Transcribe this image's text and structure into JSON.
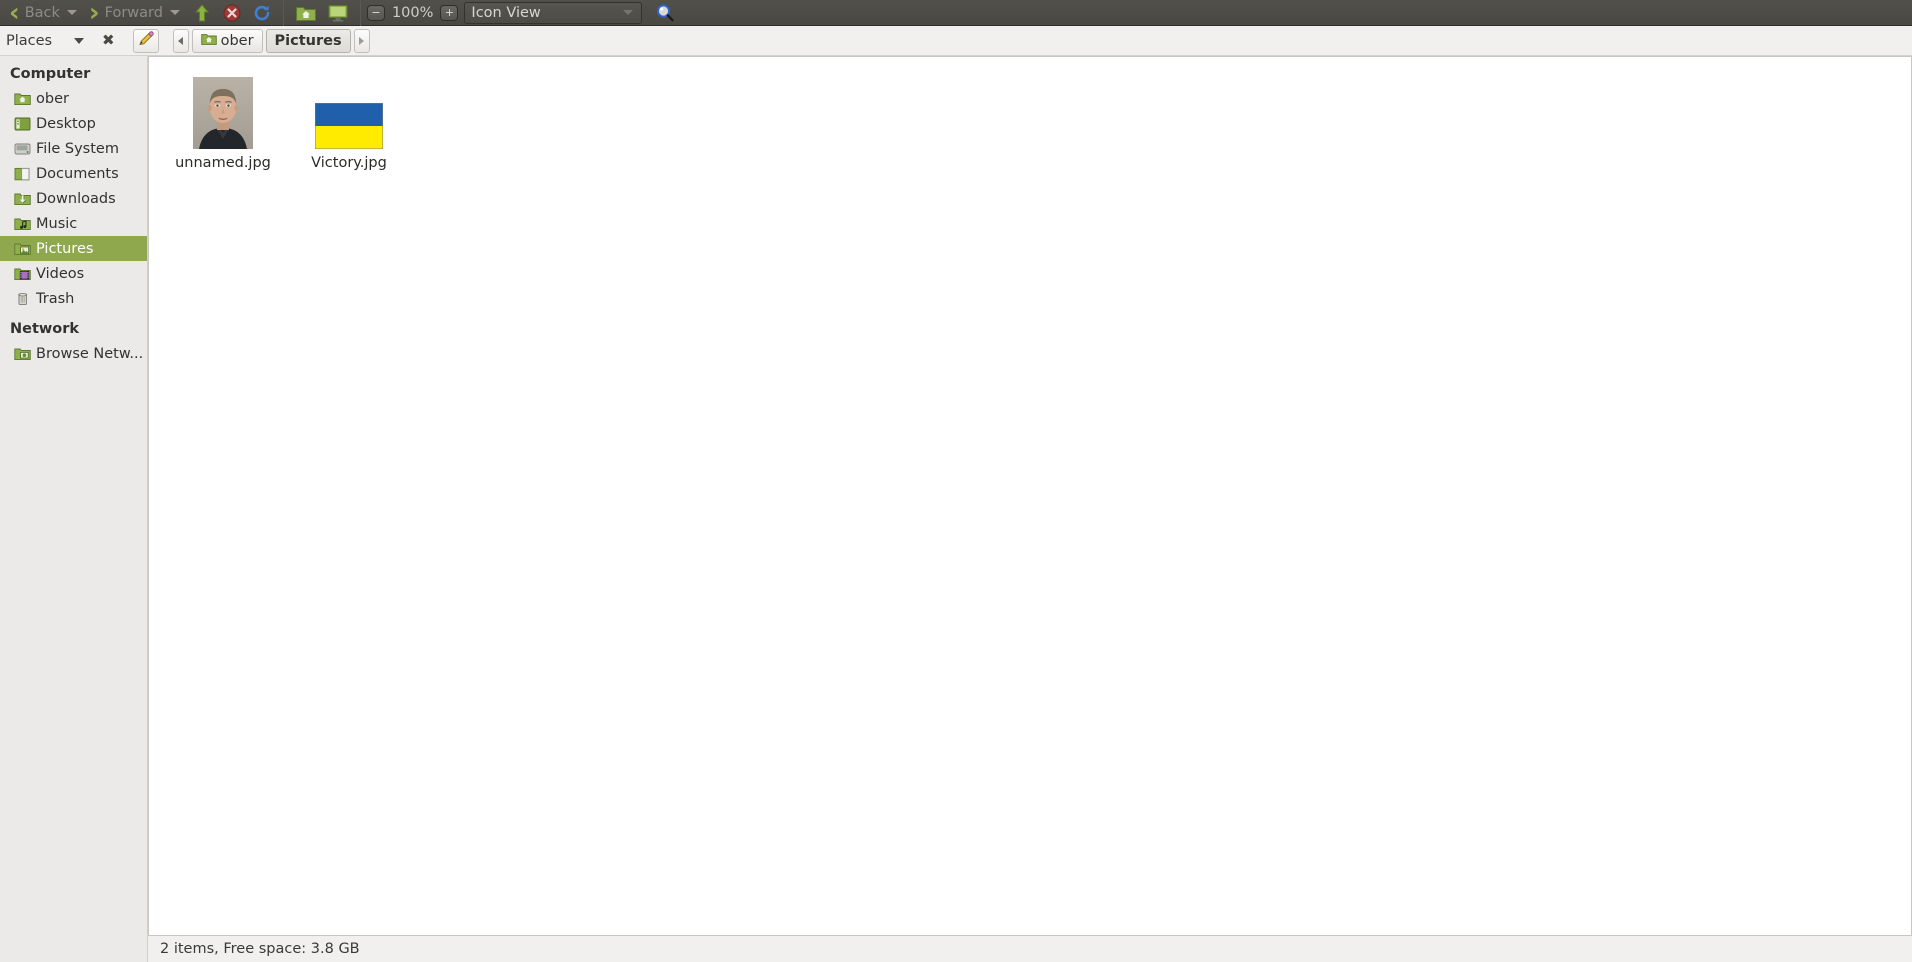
{
  "toolbar": {
    "back_label": "Back",
    "forward_label": "Forward",
    "up_icon": "arrow-up-icon",
    "stop_icon": "stop-icon",
    "reload_icon": "reload-icon",
    "home_icon": "home-folder-icon",
    "computer_icon": "computer-icon",
    "zoom_out_label": "−",
    "zoom_level": "100%",
    "zoom_in_label": "+",
    "view_mode": "Icon View",
    "search_icon": "search-icon"
  },
  "pathbar": {
    "places_label": "Places",
    "close_label": "✖",
    "edit_icon": "pencil-icon",
    "prev_icon": "chevron-left-icon",
    "next_icon": "chevron-right-icon",
    "crumbs": [
      {
        "label": "ober",
        "icon": "home-folder-icon",
        "active": false
      },
      {
        "label": "Pictures",
        "icon": "",
        "active": true
      }
    ]
  },
  "sidebar": {
    "sections": [
      {
        "title": "Computer",
        "items": [
          {
            "label": "ober",
            "icon": "home-folder-icon",
            "selected": false
          },
          {
            "label": "Desktop",
            "icon": "desktop-icon",
            "selected": false
          },
          {
            "label": "File System",
            "icon": "harddisk-icon",
            "selected": false
          },
          {
            "label": "Documents",
            "icon": "documents-icon",
            "selected": false
          },
          {
            "label": "Downloads",
            "icon": "downloads-icon",
            "selected": false
          },
          {
            "label": "Music",
            "icon": "music-icon",
            "selected": false
          },
          {
            "label": "Pictures",
            "icon": "pictures-icon",
            "selected": true
          },
          {
            "label": "Videos",
            "icon": "videos-icon",
            "selected": false
          },
          {
            "label": "Trash",
            "icon": "trash-icon",
            "selected": false
          }
        ]
      },
      {
        "title": "Network",
        "items": [
          {
            "label": "Browse Netw...",
            "icon": "network-icon",
            "selected": false
          }
        ]
      }
    ]
  },
  "files": [
    {
      "name": "unnamed.jpg",
      "thumb": "portrait-photo"
    },
    {
      "name": "Victory.jpg",
      "thumb": "ukraine-flag"
    }
  ],
  "statusbar": {
    "text": "2 items, Free space: 3.8 GB"
  },
  "colors": {
    "toolbar_bg": "#4c4a45",
    "selection": "#8fa84e",
    "flag_blue": "#1f5fab",
    "flag_yellow": "#ffeb00"
  }
}
